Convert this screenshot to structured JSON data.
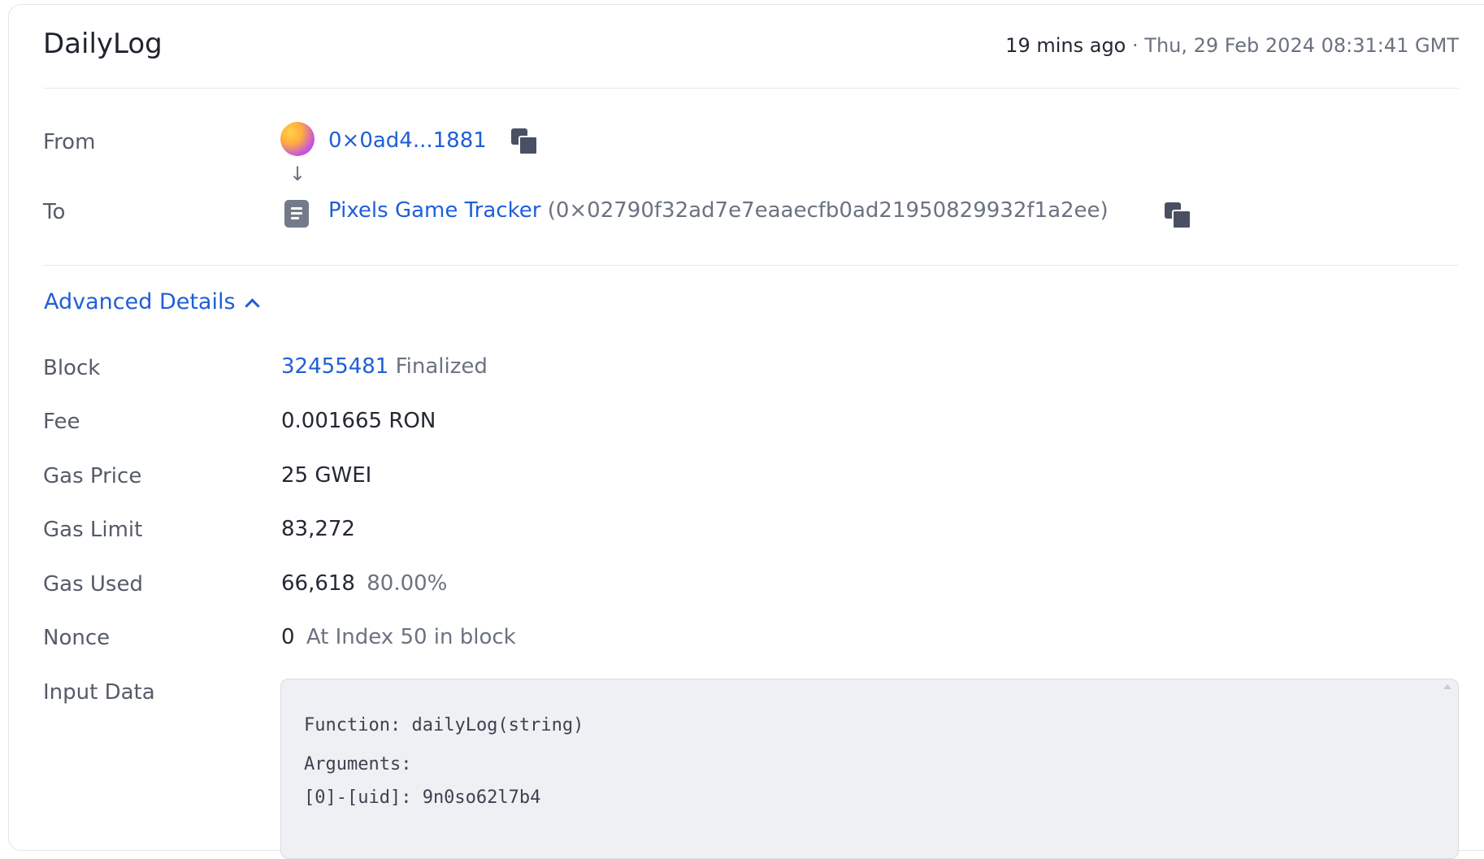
{
  "header": {
    "title": "DailyLog",
    "time_relative": "19 mins ago",
    "separator": "·",
    "time_absolute": "Thu, 29 Feb 2024 08:31:41 GMT"
  },
  "transfer": {
    "from_label": "From",
    "from_address": "0×0ad4...1881",
    "arrow": "↓",
    "to_label": "To",
    "to_name": "Pixels Game Tracker",
    "to_address": "(0×02790f32ad7e7eaaecfb0ad21950829932f1a2ee)"
  },
  "advanced": {
    "toggle_label": "Advanced Details",
    "rows": {
      "block": {
        "label": "Block",
        "number": "32455481",
        "status": "Finalized"
      },
      "fee": {
        "label": "Fee",
        "value": "0.001665 RON"
      },
      "gas_price": {
        "label": "Gas Price",
        "value": "25 GWEI"
      },
      "gas_limit": {
        "label": "Gas Limit",
        "value": "83,272"
      },
      "gas_used": {
        "label": "Gas Used",
        "value": "66,618",
        "percent": "80.00%"
      },
      "nonce": {
        "label": "Nonce",
        "value": "0",
        "index": "At Index 50 in block"
      }
    },
    "input_data": {
      "label": "Input Data",
      "function_label": "Function:",
      "function_value": "dailyLog(string)",
      "arguments_label": "Arguments:",
      "argument_0": "[0]-[uid]: 9n0so62l7b4"
    }
  },
  "icons": {
    "avatar": "gradient-avatar-icon",
    "contract": "document-icon",
    "copy": "copy-icon",
    "chevron": "chevron-up-icon"
  },
  "colors": {
    "link": "#1f5fd6",
    "text": "#242833",
    "muted": "#6b7280",
    "code_bg": "#eef0f4"
  }
}
